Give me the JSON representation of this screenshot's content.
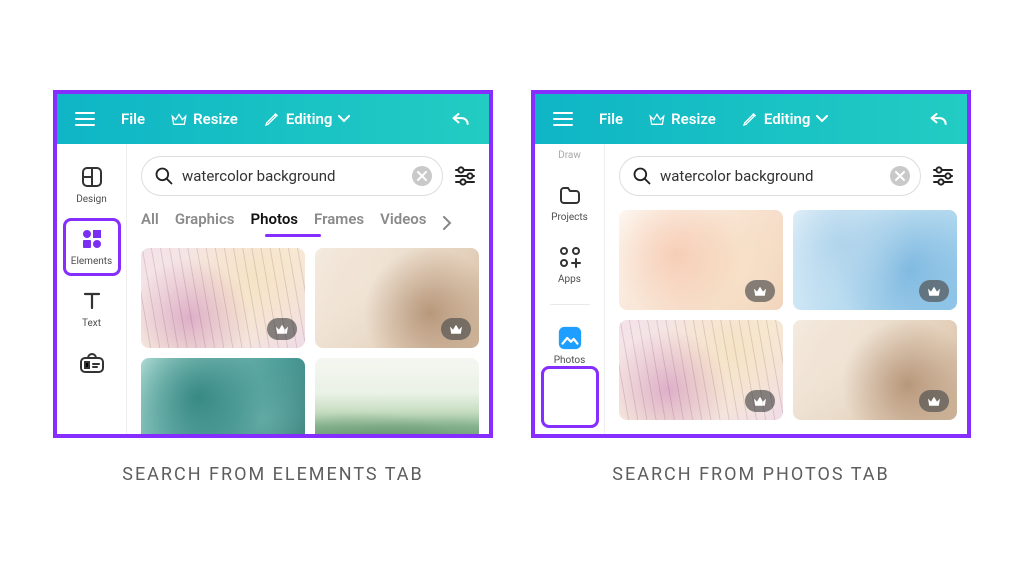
{
  "colors": {
    "accent": "#862DFF",
    "toolbar_start": "#0FB5C6",
    "toolbar_end": "#23CCC2"
  },
  "toolbar": {
    "file": "File",
    "resize": "Resize",
    "editing": "Editing"
  },
  "search": {
    "value": "watercolor background",
    "placeholder": "Search"
  },
  "left_panel": {
    "caption": "SEARCH FROM ELEMENTS TAB",
    "sidebar": [
      {
        "id": "design",
        "label": "Design"
      },
      {
        "id": "elements",
        "label": "Elements"
      },
      {
        "id": "text",
        "label": "Text"
      },
      {
        "id": "brand",
        "label": ""
      }
    ],
    "highlighted_sidebar_id": "elements",
    "category_tabs": [
      "All",
      "Graphics",
      "Photos",
      "Frames",
      "Videos"
    ],
    "active_category_index": 2,
    "thumbnails": [
      {
        "style": "wc-pink",
        "premium": true
      },
      {
        "style": "wc-brown",
        "premium": true
      },
      {
        "style": "wc-teal",
        "premium": false
      },
      {
        "style": "wc-landscape",
        "premium": false
      }
    ]
  },
  "right_panel": {
    "caption": "SEARCH FROM PHOTOS TAB",
    "sidebar": [
      {
        "id": "draw",
        "label": "Draw"
      },
      {
        "id": "projects",
        "label": "Projects"
      },
      {
        "id": "apps",
        "label": "Apps"
      },
      {
        "id": "photos",
        "label": "Photos"
      }
    ],
    "highlighted_sidebar_id": "photos",
    "thumbnails": [
      {
        "style": "wc-peach",
        "premium": true
      },
      {
        "style": "wc-blue",
        "premium": true
      },
      {
        "style": "wc-pink",
        "premium": true
      },
      {
        "style": "wc-brown",
        "premium": true
      }
    ]
  }
}
